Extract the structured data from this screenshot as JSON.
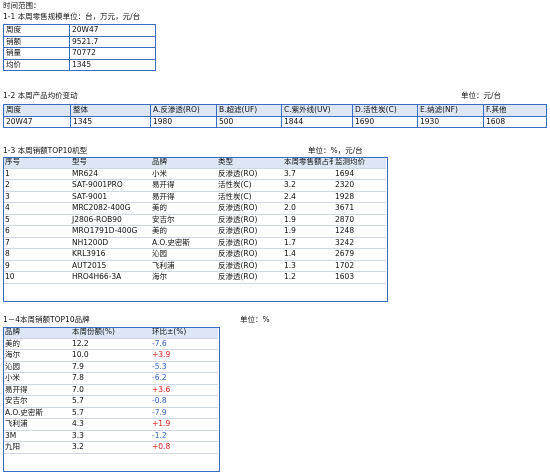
{
  "time_range_label": "时间范围：",
  "section1": {
    "title": "1-1 本周零售规模单位：台，万元，元/台",
    "rows": [
      {
        "label": "周度",
        "value": "20W47"
      },
      {
        "label": "销额",
        "value": "9521.7"
      },
      {
        "label": "销量",
        "value": "70772"
      },
      {
        "label": "均价",
        "value": "1345"
      }
    ]
  },
  "section2": {
    "title": "1-2 本周产品均价变动",
    "unit": "单位：元/台",
    "headers": [
      "周度",
      "整体",
      "A.反渗透(RO)",
      "B.超滤(UF)",
      "C.紫外线(UV)",
      "D.活性炭(C)",
      "E.纳滤(NF)",
      "F.其他"
    ],
    "values": [
      "20W47",
      "1345",
      "1980",
      "500",
      "1844",
      "1690",
      "1930",
      "1608"
    ]
  },
  "section3": {
    "title": "1-3 本周销额TOP10机型",
    "unit": "单位：%，元/台",
    "headers": [
      "序号",
      "型号",
      "品牌",
      "类型",
      "本周零售额占有率",
      "监测均价"
    ],
    "rows": [
      [
        "1",
        "MR624",
        "小米",
        "反渗透(RO)",
        "3.7",
        "1694"
      ],
      [
        "2",
        "SAT-9001PRO",
        "易开得",
        "活性炭(C)",
        "3.2",
        "2320"
      ],
      [
        "3",
        "SAT-9001",
        "易开得",
        "活性炭(C)",
        "2.4",
        "1928"
      ],
      [
        "4",
        "MRC2082-400G",
        "美的",
        "反渗透(RO)",
        "2.0",
        "3671"
      ],
      [
        "5",
        "J2806-ROB90",
        "安吉尔",
        "反渗透(RO)",
        "1.9",
        "2870"
      ],
      [
        "6",
        "MRO1791D-400G",
        "美的",
        "反渗透(RO)",
        "1.9",
        "1248"
      ],
      [
        "7",
        "NH1200D",
        "A.O.史密斯",
        "反渗透(RO)",
        "1.7",
        "3242"
      ],
      [
        "8",
        "KRL3916",
        "沁园",
        "反渗透(RO)",
        "1.4",
        "2679"
      ],
      [
        "9",
        "AUT2015",
        "飞利浦",
        "反渗透(RO)",
        "1.3",
        "1702"
      ],
      [
        "10",
        "HRO4H66-3A",
        "海尔",
        "反渗透(RO)",
        "1.2",
        "1603"
      ]
    ]
  },
  "section4": {
    "title": "1－4本周销额TOP10品牌",
    "unit": "单位：%",
    "headers": [
      "品牌",
      "本周份额(%)",
      "环比±(%)"
    ],
    "rows": [
      [
        "美的",
        "12.2",
        "-7.6"
      ],
      [
        "海尔",
        "10.0",
        "+3.9"
      ],
      [
        "沁园",
        "7.9",
        "-5.3"
      ],
      [
        "小米",
        "7.8",
        "-6.2"
      ],
      [
        "易开得",
        "7.0",
        "+3.6"
      ],
      [
        "安吉尔",
        "5.7",
        "-0.8"
      ],
      [
        "A.O.史密斯",
        "5.7",
        "-7.9"
      ],
      [
        "飞利浦",
        "4.3",
        "+1.9"
      ],
      [
        "3M",
        "3.3",
        "-1.2"
      ],
      [
        "九阳",
        "3.2",
        "+0.8"
      ]
    ],
    "colors": {
      "negative": "#2f63c4",
      "positive": "#e01b1b"
    }
  }
}
